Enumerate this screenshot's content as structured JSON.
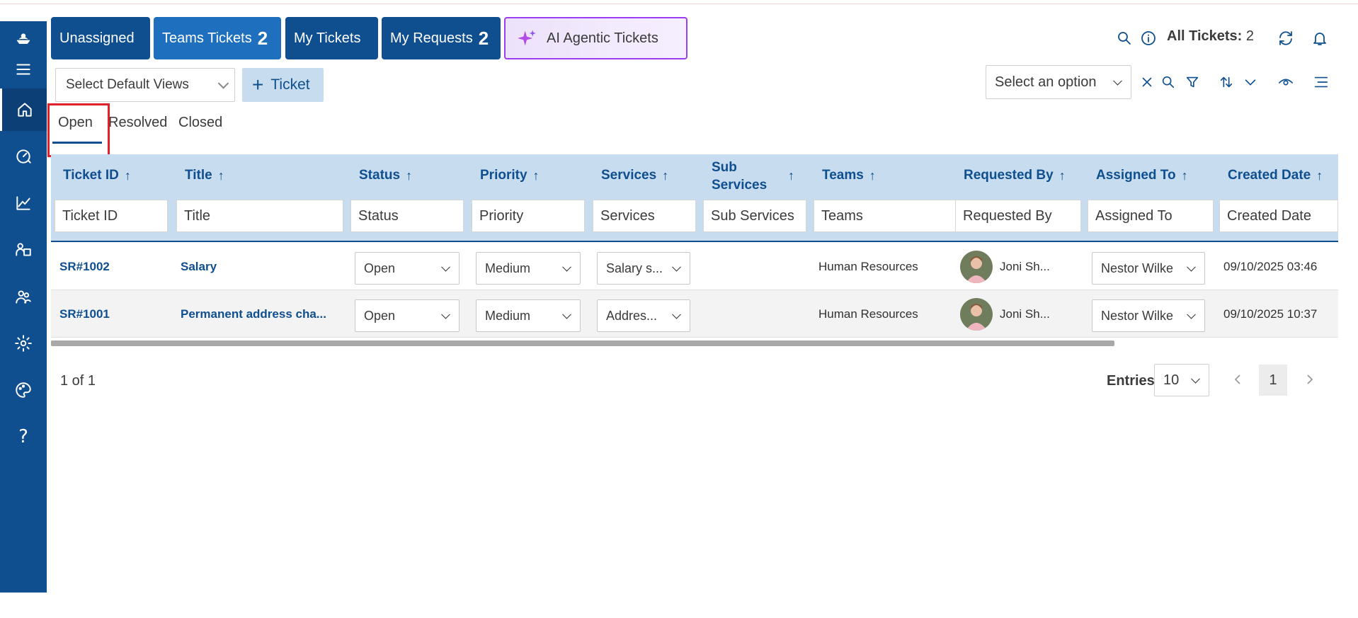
{
  "tabs": [
    {
      "label": "Unassigned",
      "count": ""
    },
    {
      "label": "Teams Tickets",
      "count": "2"
    },
    {
      "label": "My Tickets",
      "count": ""
    },
    {
      "label": "My Requests",
      "count": "2"
    },
    {
      "label": "AI Agentic Tickets",
      "count": ""
    }
  ],
  "header": {
    "all_tickets_label": "All Tickets:",
    "all_tickets_count": "2"
  },
  "toolbar": {
    "views_placeholder": "Select Default Views",
    "add_ticket_label": "Ticket",
    "option_placeholder": "Select an option"
  },
  "status_tabs": [
    "Open",
    "Resolved",
    "Closed"
  ],
  "table": {
    "columns": [
      "Ticket ID",
      "Title",
      "Status",
      "Priority",
      "Services",
      "Sub Services",
      "Teams",
      "Requested By",
      "Assigned To",
      "Created Date"
    ],
    "sub_services_line1": "Sub",
    "sub_services_line2": "Services",
    "filters": [
      "Ticket ID",
      "Title",
      "Status",
      "Priority",
      "Services",
      "Sub Services",
      "Teams",
      "Requested By",
      "Assigned To",
      "Created Date"
    ],
    "rows": [
      {
        "id": "SR#1002",
        "title": "Salary",
        "status": "Open",
        "priority": "Medium",
        "services": "Salary s...",
        "sub_services": "",
        "teams": "Human Resources",
        "requested_by": "Joni Sh...",
        "assigned_to": "Nestor Wilke",
        "created": "09/10/2025 03:46"
      },
      {
        "id": "SR#1001",
        "title": "Permanent address cha...",
        "status": "Open",
        "priority": "Medium",
        "services": "Addres...",
        "sub_services": "",
        "teams": "Human Resources",
        "requested_by": "Joni Sh...",
        "assigned_to": "Nestor Wilke",
        "created": "09/10/2025 10:37"
      }
    ]
  },
  "pager": {
    "info": "1 of 1",
    "entries_label": "Entries",
    "entries_value": "10",
    "current_page": "1"
  },
  "colors": {
    "primary": "#0f4f8f",
    "header_bg": "#c7dcee",
    "ai_border": "#9b3df0",
    "highlight": "#e0202a"
  },
  "icons": {
    "sidebar": [
      "logo-icon",
      "menu-icon",
      "home-icon",
      "dashboard-icon",
      "chart-icon",
      "assets-icon",
      "users-icon",
      "settings-icon",
      "palette-icon",
      "help-icon"
    ],
    "top_right": [
      "search-icon",
      "info-icon",
      "refresh-icon",
      "bell-icon"
    ],
    "tools": [
      "clear-icon",
      "search-icon",
      "filter-icon",
      "sort-icon",
      "chevron-down-icon",
      "eye-icon",
      "column-menu-icon"
    ]
  }
}
